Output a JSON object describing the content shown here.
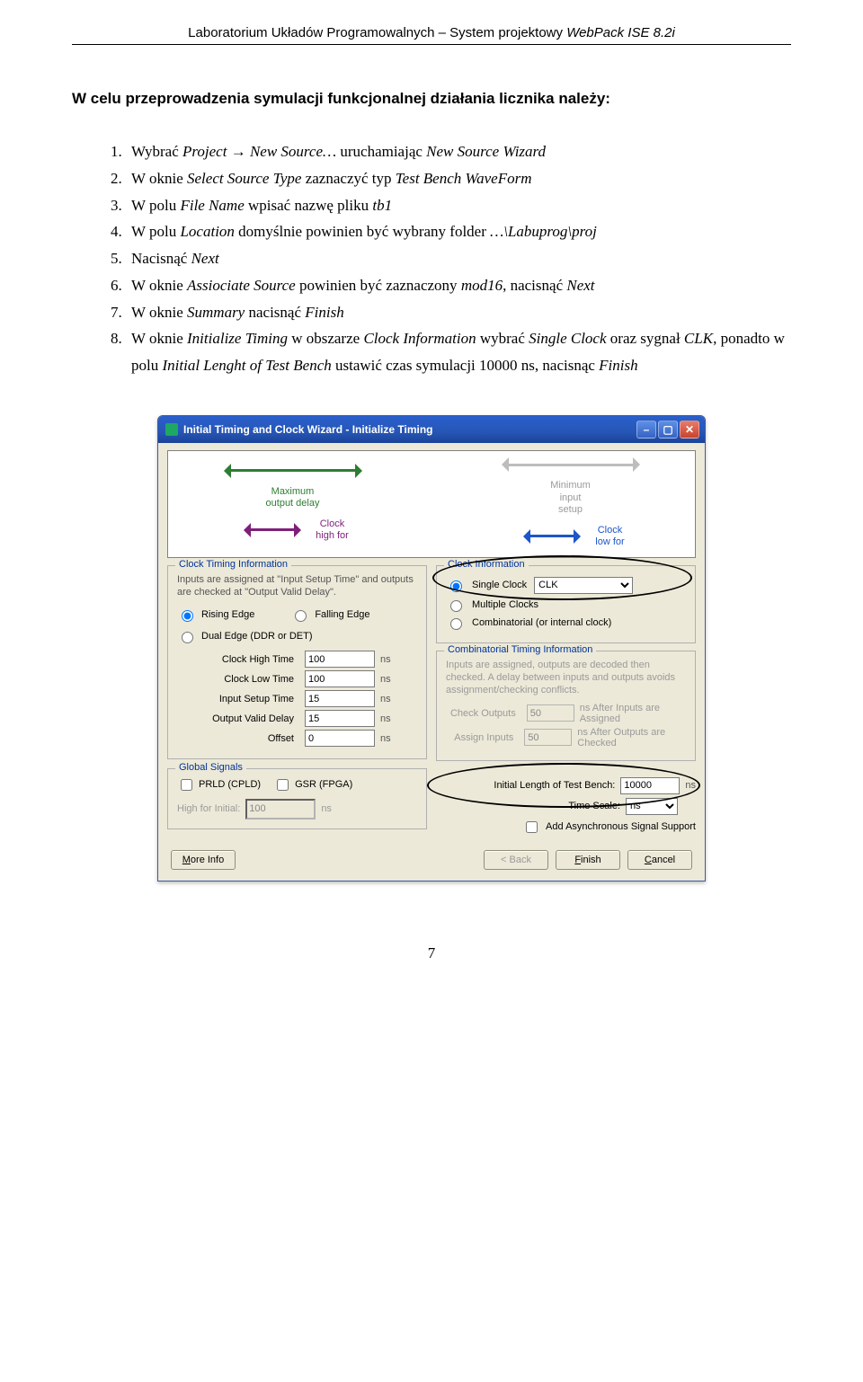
{
  "header": {
    "left": "Laboratorium Układów Programowalnych – System projektowy ",
    "italic": "WebPack ISE 8.2i"
  },
  "intro": "W celu przeprowadzenia symulacji funkcjonalnej działania licznika należy:",
  "steps": {
    "s1a": "Wybrać ",
    "s1b": "Project → New Source…",
    "s1c": " uruchamiając ",
    "s1d": "New Source Wizard",
    "s2a": "W oknie ",
    "s2b": "Select Source Type",
    "s2c": " zaznaczyć typ ",
    "s2d": "Test Bench WaveForm",
    "s3a": "W polu ",
    "s3b": "File Name",
    "s3c": " wpisać nazwę pliku ",
    "s3d": "tb1",
    "s4a": "W polu ",
    "s4b": "Location",
    "s4c": " domyślnie powinien być wybrany folder ",
    "s4d": "…\\Labuprog\\proj",
    "s5a": "Nacisnąć ",
    "s5b": "Next",
    "s6a": "W oknie ",
    "s6b": "Assiociate Source",
    "s6c": " powinien być zaznaczony ",
    "s6d": "mod16",
    "s6e": ", nacisnąć ",
    "s6f": "Next",
    "s7a": "W oknie ",
    "s7b": "Summary",
    "s7c": " nacisnąć ",
    "s7d": "Finish",
    "s8a": "W oknie ",
    "s8b": "Initialize Timing",
    "s8c": " w obszarze ",
    "s8d": "Clock Information",
    "s8e": " wybrać ",
    "s8f": "Single Clock",
    "s8g": " oraz sygnał ",
    "s8h": "CLK",
    "s8i": ", ponadto w polu ",
    "s8j": "Initial Lenght of Test Bench",
    "s8k": " ustawić czas symulacji 10000 ns, nacisnąc ",
    "s8l": "Finish"
  },
  "dialog": {
    "title": "Initial Timing and Clock Wizard - Initialize Timing",
    "canvas": {
      "maxout": "Maximum\noutput delay",
      "minin": "Minimum\ninput\nsetup",
      "clkhigh": "Clock\nhigh for",
      "clklow": "Clock\nlow for"
    },
    "cti": {
      "legend": "Clock Timing Information",
      "note": "Inputs are assigned at \"Input Setup Time\" and outputs are checked at \"Output Valid Delay\".",
      "rising": "Rising Edge",
      "falling": "Falling Edge",
      "dual": "Dual Edge (DDR or DET)",
      "rows": {
        "cht": "Clock High Time",
        "cht_v": "100",
        "clt": "Clock Low Time",
        "clt_v": "100",
        "ist": "Input Setup Time",
        "ist_v": "15",
        "ovd": "Output Valid Delay",
        "ovd_v": "15",
        "off": "Offset",
        "off_v": "0"
      },
      "unit": "ns"
    },
    "ci": {
      "legend": "Clock Information",
      "single": "Single Clock",
      "single_val": "CLK",
      "multiple": "Multiple Clocks",
      "comb": "Combinatorial (or internal clock)"
    },
    "cti2": {
      "legend": "Combinatorial Timing Information",
      "note": "Inputs are assigned, outputs are decoded then checked. A delay between inputs and outputs avoids assignment/checking conflicts.",
      "co": "Check Outputs",
      "co_v": "50",
      "co_tail": "ns  After Inputs are Assigned",
      "ai": "Assign Inputs",
      "ai_v": "50",
      "ai_tail": "ns  After Outputs are Checked"
    },
    "gs": {
      "legend": "Global Signals",
      "prld": "PRLD (CPLD)",
      "gsr": "GSR (FPGA)",
      "high": "High for Initial:",
      "high_v": "100",
      "unit": "ns"
    },
    "right": {
      "ilotb": "Initial Length of Test Bench:",
      "ilotb_v": "10000",
      "unit": "ns",
      "ts": "Time Scale:",
      "ts_v": "ns",
      "addasync": "Add Asynchronous Signal Support"
    },
    "buttons": {
      "moreinfo": "More Info",
      "back": "< Back",
      "finish": "Finish",
      "cancel": "Cancel"
    }
  },
  "page_number": "7"
}
